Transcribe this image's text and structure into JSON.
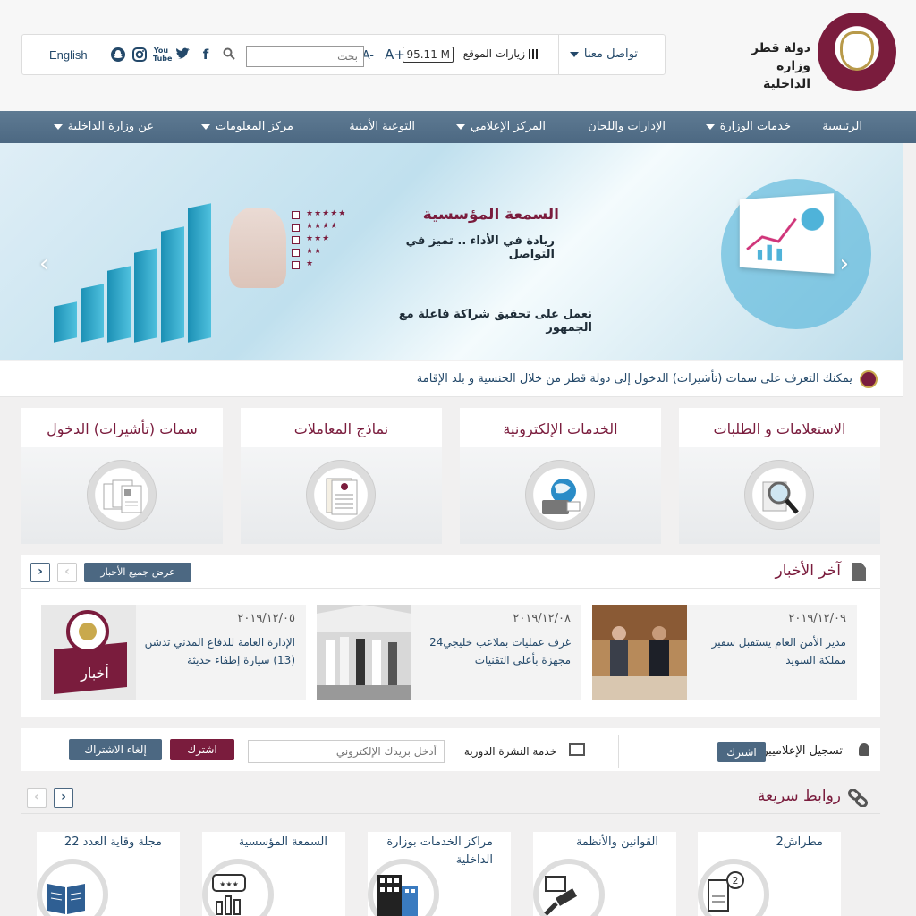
{
  "header": {
    "logo_line1": "دولة قطر",
    "logo_line2": "وزارة الداخلية",
    "contact_label": "تواصل معنا",
    "visits_label": "زيارات الموقع",
    "visits_count": "95.11 M",
    "font_increase": "A+",
    "font_decrease": "A-",
    "search_placeholder": "بحث",
    "social_icons": [
      "facebook-icon",
      "twitter-icon",
      "youtube-icon",
      "instagram-icon",
      "snapchat-icon"
    ],
    "youtube_text": "You Tube",
    "language_link": "English"
  },
  "nav": {
    "items": [
      "الرئيسية",
      "خدمات الوزارة",
      "الإدارات واللجان",
      "المركز الإعلامي",
      "التوعية الأمنية",
      "مركز المعلومات",
      "عن وزارة الداخلية"
    ]
  },
  "banner": {
    "title": "السمعة المؤسسية",
    "subtitle": "ريادة في الأداء .. تميز في التواصل",
    "bottom_text": "نعمل على تحقيق شراكة فاعلة مع الجمهور"
  },
  "ticker": {
    "text": "يمكنك التعرف على سمات (تأشيرات) الدخول إلى دولة قطر من خلال الجنسية و بلد الإقامة"
  },
  "services": [
    {
      "title": "الاستعلامات و الطلبات",
      "icon": "magnifier-icon"
    },
    {
      "title": "الخدمات الإلكترونية",
      "icon": "globe-laptop-icon"
    },
    {
      "title": "نماذج المعاملات",
      "icon": "forms-icon"
    },
    {
      "title": "سمات (تأشيرات) الدخول",
      "icon": "visa-documents-icon"
    }
  ],
  "news": {
    "title": "آخر الأخبار",
    "all_news_button": "عرض جميع الأخبار",
    "prev": "‹",
    "next": "›",
    "items": [
      {
        "date": "٢٠١٩/١٢/٠٩",
        "text": "مدير الأمن العام يستقبل سفير مملكة السويد"
      },
      {
        "date": "٢٠١٩/١٢/٠٨",
        "text": "غرف عمليات بملاعب خليجي24 مجهزة بأعلى التقنيات"
      },
      {
        "date": "٢٠١٩/١٢/٠٥",
        "text": "الإدارة العامة للدفاع المدني تدشن (13) سيارة إطفاء حديثة"
      }
    ],
    "news_badge": "أخبار"
  },
  "subscription": {
    "media_label": "تسجيل الإعلاميين :",
    "media_button": "اشترك",
    "newsletter_label": "خدمة النشرة الدورية",
    "email_placeholder": "أدخل بريدك الإلكتروني",
    "subscribe_button": "اشترك",
    "unsubscribe_button": "إلغاء الاشتراك"
  },
  "quick_links": {
    "title": "روابط سريعة",
    "prev": "‹",
    "next": "›",
    "items": [
      {
        "label": "مطراش2",
        "icon": "metrash-app-icon"
      },
      {
        "label": "القوانين والأنظمة",
        "icon": "gavel-icon"
      },
      {
        "label": "مراكز الخدمات بوزارة الداخلية",
        "icon": "buildings-icon"
      },
      {
        "label": "السمعة المؤسسية",
        "icon": "reputation-chart-icon"
      },
      {
        "label": "مجلة وقاية العدد 22",
        "icon": "magazine-icon"
      }
    ]
  },
  "colors": {
    "maroon": "#7a1c3d",
    "navy": "#24496a",
    "steel": "#4c6882"
  }
}
